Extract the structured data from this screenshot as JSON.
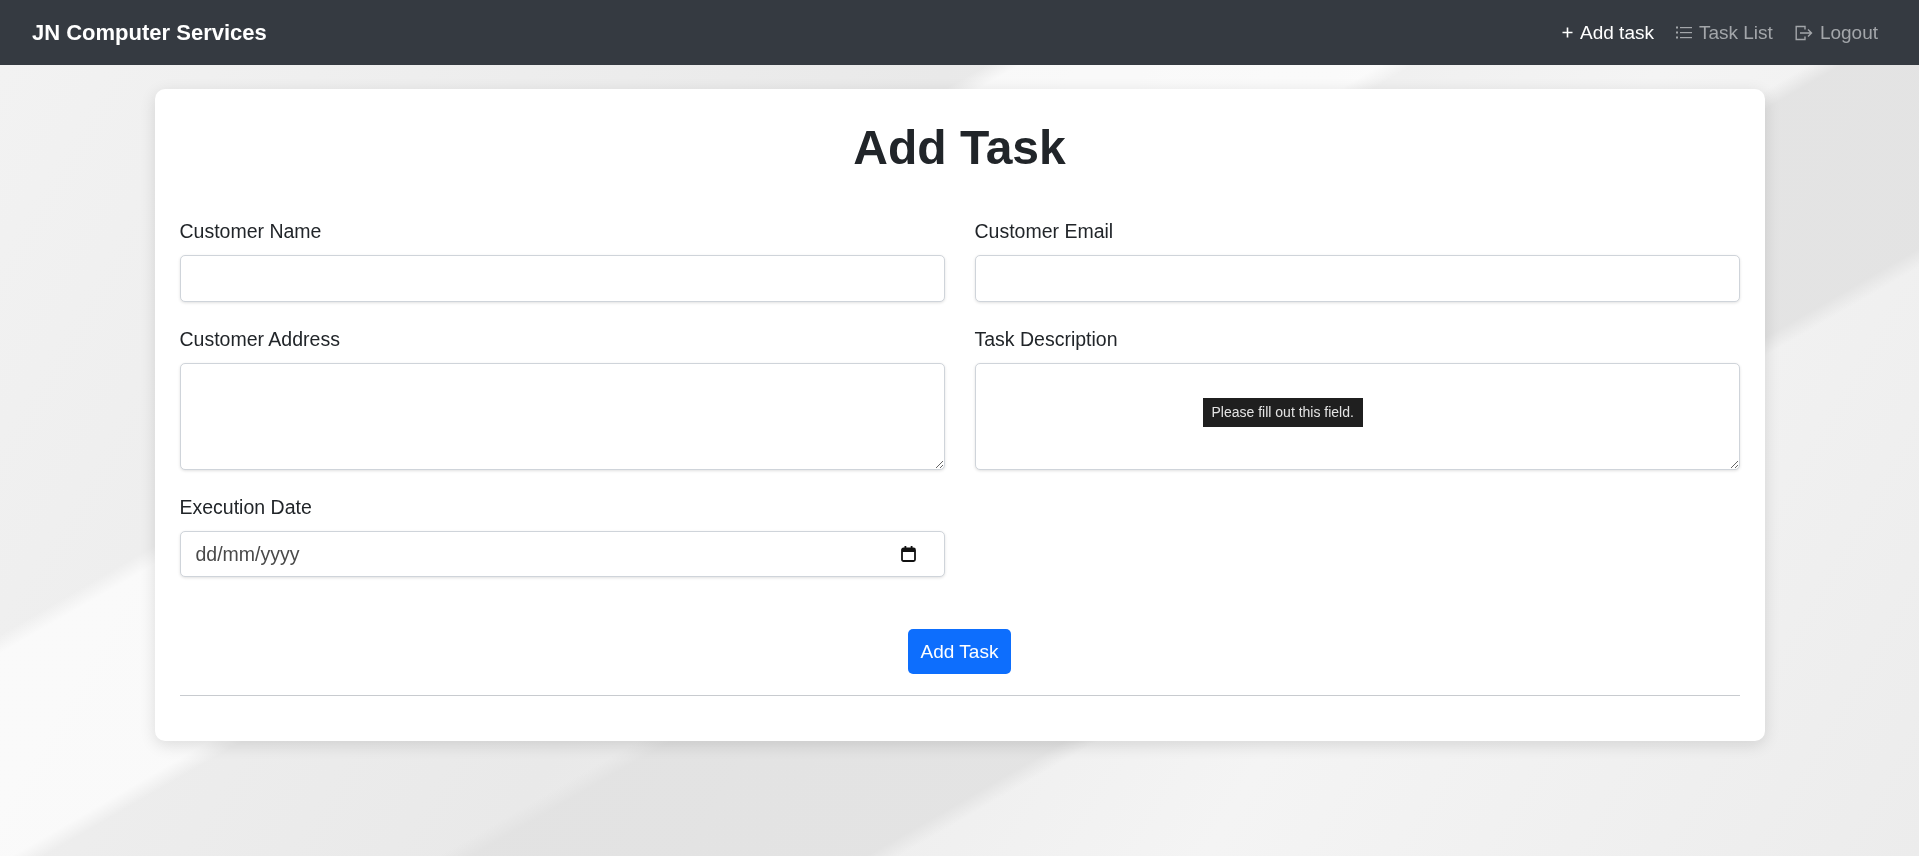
{
  "navbar": {
    "brand": "JN Computer Services",
    "links": [
      {
        "label": "Add task",
        "selected": true
      },
      {
        "label": "Task List",
        "selected": false
      },
      {
        "label": "Logout",
        "selected": false
      }
    ]
  },
  "form": {
    "title": "Add Task",
    "fields": [
      {
        "label": "Customer Name",
        "kind": "text"
      },
      {
        "label": "Customer Email",
        "kind": "text"
      },
      {
        "label": "Customer Address",
        "kind": "textarea"
      },
      {
        "label": "Task Description",
        "kind": "textarea",
        "validation_message": "Please fill out this field."
      },
      {
        "label": "Execution Date",
        "kind": "date",
        "placeholder": "dd/mm/yyyy"
      }
    ],
    "submit": "Add Task"
  }
}
